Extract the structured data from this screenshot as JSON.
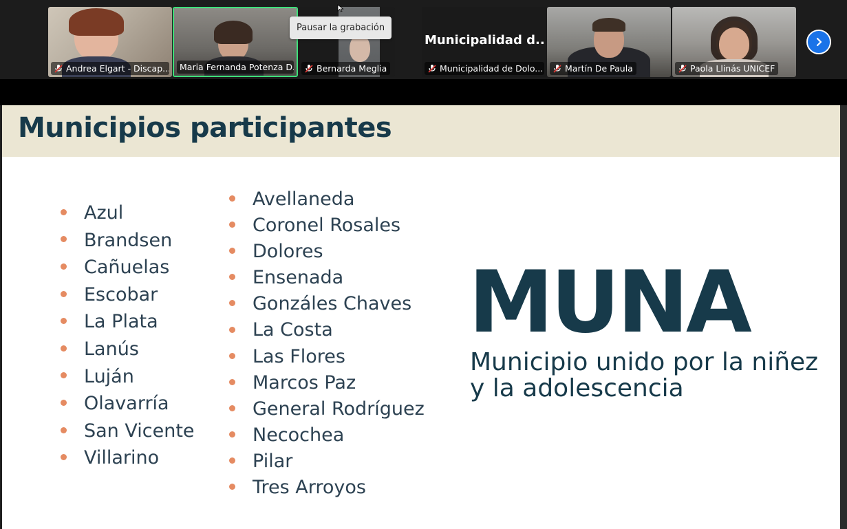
{
  "participants": [
    {
      "name": "Andrea Elgart - Discap...",
      "muted": true
    },
    {
      "name": "Maria Fernanda Potenza D...",
      "muted": false,
      "active_speaker": true
    },
    {
      "name": "Bernarda Meglia",
      "muted": true
    },
    {
      "name": "Municipalidad de Dolo...",
      "muted": true,
      "display_text": "Municipalidad  d..."
    },
    {
      "name": "Martín De Paula",
      "muted": true
    },
    {
      "name": "Paola Llinás UNICEF",
      "muted": true
    }
  ],
  "tooltip": {
    "text": "Pausar la grabación"
  },
  "slide": {
    "title": "Municipios participantes",
    "list_left": [
      "Azul",
      "Brandsen",
      "Cañuelas",
      "Escobar",
      "La Plata",
      "Lanús",
      "Luján",
      "Olavarría",
      "San Vicente",
      "Villarino"
    ],
    "list_right": [
      "Avellaneda",
      "Coronel Rosales",
      "Dolores",
      "Ensenada",
      "Gonzáles Chaves",
      "La Costa",
      "Las Flores",
      "Marcos Paz",
      "General Rodríguez",
      "Necochea",
      "Pilar",
      "Tres Arroyos"
    ],
    "logo": {
      "wordmark": "MUNA",
      "tagline_line1": "Municipio unido por la niñez",
      "tagline_line2": "y la adolescencia"
    }
  },
  "colors": {
    "accent_green": "#3ee07a",
    "next_button": "#1a73e8",
    "slide_header_bg": "#ebe6d3",
    "slide_title": "#173a4a",
    "bullet": "#e58b62"
  }
}
